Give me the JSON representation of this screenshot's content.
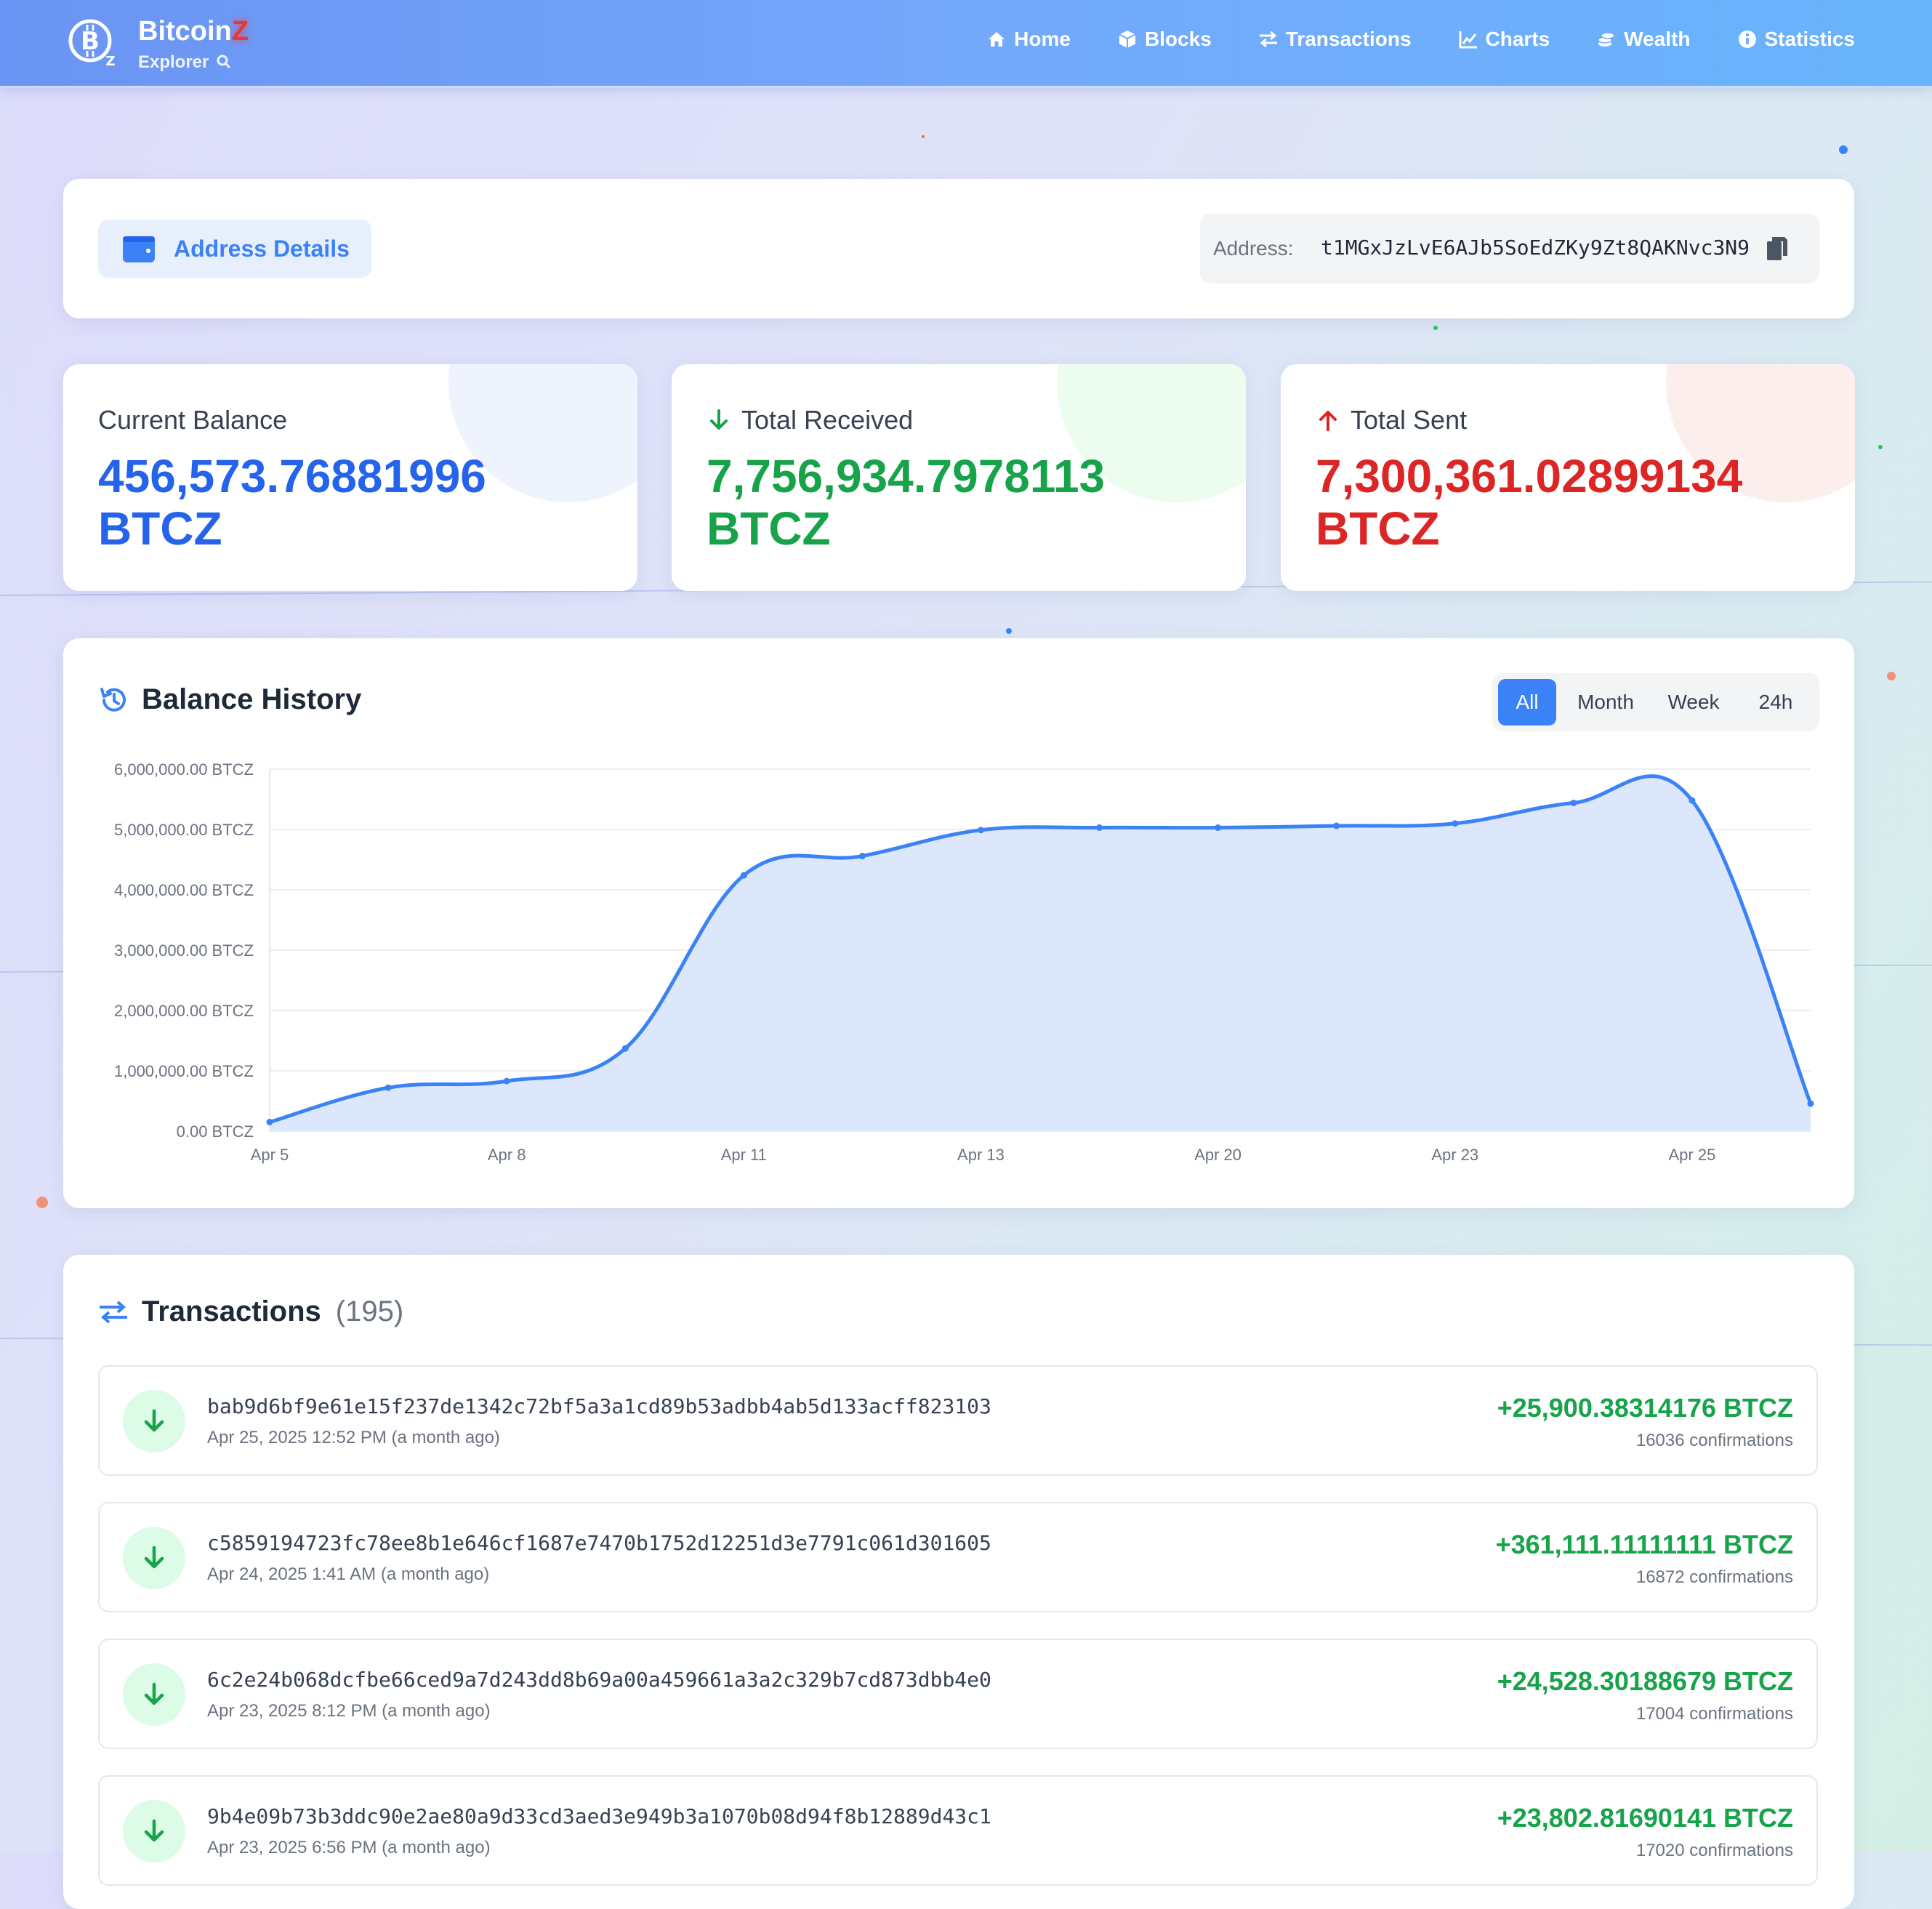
{
  "brand": {
    "name_main": "Bitcoin",
    "name_accent": "Z",
    "subtitle": "Explorer"
  },
  "nav": [
    {
      "label": "Home",
      "icon": "home-icon"
    },
    {
      "label": "Blocks",
      "icon": "cube-icon"
    },
    {
      "label": "Transactions",
      "icon": "exchange-icon"
    },
    {
      "label": "Charts",
      "icon": "line-chart-icon"
    },
    {
      "label": "Wealth",
      "icon": "coins-icon"
    },
    {
      "label": "Statistics",
      "icon": "info-icon"
    }
  ],
  "address_card": {
    "title": "Address Details",
    "address_label": "Address:",
    "address": "t1MGxJzLvE6AJb5SoEdZKy9Zt8QAKNvc3N9"
  },
  "stats": {
    "balance": {
      "label": "Current Balance",
      "amount": "456,573.76881996",
      "unit": "BTCZ",
      "color": "#2563eb"
    },
    "received": {
      "label": "Total Received",
      "amount": "7,756,934.7978113",
      "unit": "BTCZ",
      "color": "#16a34a"
    },
    "sent": {
      "label": "Total Sent",
      "amount": "7,300,361.02899134",
      "unit": "BTCZ",
      "color": "#dc2626"
    }
  },
  "balance_history": {
    "title": "Balance History",
    "ranges": [
      "All",
      "Month",
      "Week",
      "24h"
    ],
    "active_range": "All"
  },
  "chart_data": {
    "type": "area",
    "x_ticks": [
      "Apr 5",
      "Apr 8",
      "Apr 11",
      "Apr 13",
      "Apr 20",
      "Apr 23",
      "Apr 25"
    ],
    "y_ticks": [
      "0.00 BTCZ",
      "1,000,000.00 BTCZ",
      "2,000,000.00 BTCZ",
      "3,000,000.00 BTCZ",
      "4,000,000.00 BTCZ",
      "5,000,000.00 BTCZ",
      "6,000,000.00 BTCZ"
    ],
    "ylim": [
      0,
      6000000
    ],
    "grid": true,
    "legend": "none",
    "line_color": "#3b82f6",
    "fill_color": "#dbe6fb",
    "values": [
      150000,
      720000,
      830000,
      1370000,
      4240000,
      4560000,
      4990000,
      5030000,
      5030000,
      5060000,
      5100000,
      5440000,
      5480000,
      456574
    ]
  },
  "transactions": {
    "title": "Transactions",
    "count": "(195)",
    "items": [
      {
        "hash": "bab9d6bf9e61e15f237de1342c72bf5a3a1cd89b53adbb4ab5d133acff823103",
        "time": "Apr 25, 2025 12:52 PM (a month ago)",
        "amount": "+25,900.38314176 BTCZ",
        "confirmations": "16036 confirmations"
      },
      {
        "hash": "c5859194723fc78ee8b1e646cf1687e7470b1752d12251d3e7791c061d301605",
        "time": "Apr 24, 2025 1:41 AM (a month ago)",
        "amount": "+361,111.11111111 BTCZ",
        "confirmations": "16872 confirmations"
      },
      {
        "hash": "6c2e24b068dcfbe66ced9a7d243dd8b69a00a459661a3a2c329b7cd873dbb4e0",
        "time": "Apr 23, 2025 8:12 PM (a month ago)",
        "amount": "+24,528.30188679 BTCZ",
        "confirmations": "17004 confirmations"
      },
      {
        "hash": "9b4e09b73b3ddc90e2ae80a9d33cd3aed3e949b3a1070b08d94f8b12889d43c1",
        "time": "Apr 23, 2025 6:56 PM (a month ago)",
        "amount": "+23,802.81690141 BTCZ",
        "confirmations": "17020 confirmations"
      }
    ]
  }
}
